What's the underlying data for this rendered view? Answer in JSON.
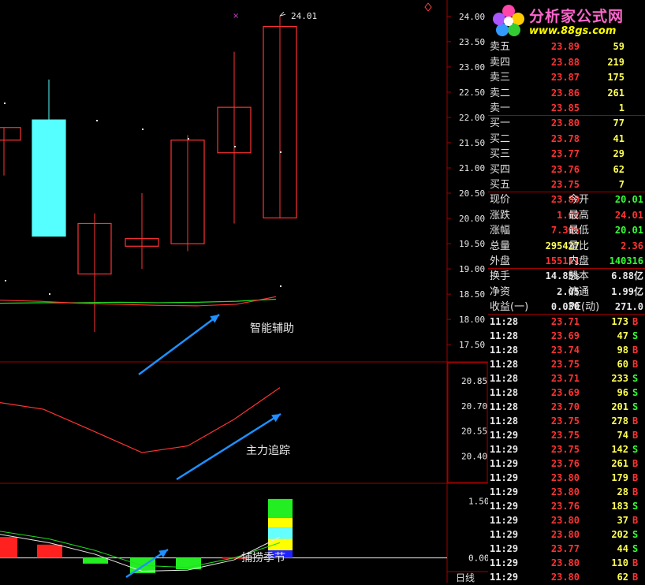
{
  "logo": {
    "brand": "分析家公式网",
    "url": "www.88gs.com"
  },
  "price_axis": [
    "24.00",
    "23.50",
    "23.00",
    "22.50",
    "22.00",
    "21.50",
    "21.00",
    "20.50",
    "20.00",
    "19.50",
    "19.00",
    "18.50",
    "18.00",
    "17.50"
  ],
  "indicator_axis": [
    "20.85",
    "20.70",
    "20.55",
    "20.40"
  ],
  "osc_axis": [
    "1.50",
    "0.00"
  ],
  "high_marker": "24.01",
  "annotations": {
    "ind1": "智能辅助",
    "ind2": "主力追踪",
    "ind3": "捕捞季节"
  },
  "period": "日线",
  "sell_orders": [
    {
      "label": "卖五",
      "price": "23.89",
      "vol": "59"
    },
    {
      "label": "卖四",
      "price": "23.88",
      "vol": "219"
    },
    {
      "label": "卖三",
      "price": "23.87",
      "vol": "175"
    },
    {
      "label": "卖二",
      "price": "23.86",
      "vol": "261"
    },
    {
      "label": "卖一",
      "price": "23.85",
      "vol": "1"
    }
  ],
  "buy_orders": [
    {
      "label": "买一",
      "price": "23.80",
      "vol": "77"
    },
    {
      "label": "买二",
      "price": "23.78",
      "vol": "41"
    },
    {
      "label": "买三",
      "price": "23.77",
      "vol": "29"
    },
    {
      "label": "买四",
      "price": "23.76",
      "vol": "62"
    },
    {
      "label": "买五",
      "price": "23.75",
      "vol": "7"
    }
  ],
  "quote": [
    {
      "l1": "现价",
      "v1": "23.80",
      "c1": "red",
      "l2": "今开",
      "v2": "20.01",
      "c2": "green"
    },
    {
      "l1": "涨跌",
      "v1": "1.62",
      "c1": "red",
      "l2": "最高",
      "v2": "24.01",
      "c2": "red"
    },
    {
      "l1": "涨幅",
      "v1": "7.30%",
      "c1": "red",
      "l2": "最低",
      "v2": "20.01",
      "c2": "green"
    },
    {
      "l1": "总量",
      "v1": "295427",
      "c1": "yellow",
      "l2": "量比",
      "v2": "2.36",
      "c2": "red"
    },
    {
      "l1": "外盘",
      "v1": "155111",
      "c1": "red",
      "l2": "内盘",
      "v2": "140316",
      "c2": "green"
    }
  ],
  "fund": [
    {
      "l1": "换手",
      "v1": "14.85%",
      "l2": "股本",
      "v2": "6.88亿"
    },
    {
      "l1": "净资",
      "v1": "2.05",
      "l2": "流通",
      "v2": "1.99亿"
    },
    {
      "l1": "收益(一)",
      "v1": "0.030",
      "l2": "PE(动)",
      "v2": "271.0"
    }
  ],
  "ticks": [
    {
      "time": "11:28",
      "price": "23.71",
      "pc": "red",
      "vol": "173",
      "side": "B"
    },
    {
      "time": "11:28",
      "price": "23.69",
      "pc": "red",
      "vol": "47",
      "side": "S"
    },
    {
      "time": "11:28",
      "price": "23.74",
      "pc": "red",
      "vol": "98",
      "side": "B"
    },
    {
      "time": "11:28",
      "price": "23.75",
      "pc": "red",
      "vol": "60",
      "side": "B"
    },
    {
      "time": "11:28",
      "price": "23.71",
      "pc": "red",
      "vol": "233",
      "side": "S"
    },
    {
      "time": "11:28",
      "price": "23.69",
      "pc": "red",
      "vol": "96",
      "side": "S"
    },
    {
      "time": "11:28",
      "price": "23.70",
      "pc": "red",
      "vol": "201",
      "side": "S"
    },
    {
      "time": "11:28",
      "price": "23.75",
      "pc": "red",
      "vol": "278",
      "side": "B"
    },
    {
      "time": "11:29",
      "price": "23.75",
      "pc": "red",
      "vol": "74",
      "side": "B"
    },
    {
      "time": "11:29",
      "price": "23.75",
      "pc": "red",
      "vol": "142",
      "side": "S"
    },
    {
      "time": "11:29",
      "price": "23.76",
      "pc": "red",
      "vol": "261",
      "side": "B"
    },
    {
      "time": "11:29",
      "price": "23.80",
      "pc": "red",
      "vol": "179",
      "side": "B"
    },
    {
      "time": "11:29",
      "price": "23.80",
      "pc": "red",
      "vol": "28",
      "side": "B"
    },
    {
      "time": "11:29",
      "price": "23.76",
      "pc": "red",
      "vol": "183",
      "side": "S"
    },
    {
      "time": "11:29",
      "price": "23.80",
      "pc": "red",
      "vol": "37",
      "side": "B"
    },
    {
      "time": "11:29",
      "price": "23.80",
      "pc": "red",
      "vol": "202",
      "side": "S"
    },
    {
      "time": "11:29",
      "price": "23.77",
      "pc": "red",
      "vol": "44",
      "side": "S"
    },
    {
      "time": "11:29",
      "price": "23.80",
      "pc": "red",
      "vol": "110",
      "side": "B"
    },
    {
      "time": "11:29",
      "price": "23.80",
      "pc": "red",
      "vol": "62",
      "side": "B"
    }
  ],
  "colors": {
    "up": "#ff3333",
    "down": "#55ffff",
    "grid": "#a00000",
    "arrow": "#1e90ff",
    "buy_side": "#ff3333",
    "sell_side": "#33ff33"
  },
  "chart_data": {
    "type": "candlestick",
    "candles": [
      {
        "open": 21.55,
        "close": 21.8,
        "high": 21.8,
        "low": 20.85,
        "dir": "up"
      },
      {
        "open": 21.95,
        "close": 19.65,
        "high": 22.75,
        "low": 19.65,
        "dir": "down"
      },
      {
        "open": 18.9,
        "close": 19.9,
        "high": 20.1,
        "low": 17.75,
        "dir": "up"
      },
      {
        "open": 19.45,
        "close": 19.6,
        "high": 20.5,
        "low": 19.0,
        "dir": "up"
      },
      {
        "open": 19.5,
        "close": 21.55,
        "high": 21.65,
        "low": 19.35,
        "dir": "up"
      },
      {
        "open": 21.3,
        "close": 22.2,
        "high": 23.3,
        "low": 19.9,
        "dir": "up"
      },
      {
        "open": 20.01,
        "close": 23.8,
        "high": 24.01,
        "low": 20.01,
        "dir": "up"
      }
    ],
    "price_range": [
      17.3,
      24.2
    ],
    "ma_green": [
      18.32,
      18.33,
      18.33,
      18.34,
      18.33,
      18.34,
      18.36,
      18.4
    ],
    "ma_red": [
      18.38,
      18.36,
      18.32,
      18.3,
      18.28,
      18.27,
      18.3,
      18.45
    ],
    "ind2_line": [
      20.72,
      20.68,
      20.55,
      20.42,
      20.46,
      20.62,
      20.81
    ],
    "ind2_range": [
      20.25,
      20.95
    ],
    "osc_bars": [
      {
        "value": 0.55,
        "color": "#ff2020"
      },
      {
        "value": 0.35,
        "color": "#ff2020"
      },
      {
        "value": -0.15,
        "color": "#22ee22"
      },
      {
        "value": -0.4,
        "color": "#22ee22"
      },
      {
        "value": -0.3,
        "color": "#22ee22"
      },
      {
        "value": 0.02,
        "color": "#ff2020"
      }
    ],
    "osc_stack": [
      {
        "from": 1.05,
        "to": 1.55,
        "color": "#22ee22"
      },
      {
        "from": 0.8,
        "to": 1.05,
        "color": "#ffff00"
      },
      {
        "from": 0.5,
        "to": 0.8,
        "color": "#66ffff"
      },
      {
        "from": 0.2,
        "to": 0.5,
        "color": "#ffff00"
      },
      {
        "from": 0.0,
        "to": 0.2,
        "color": "#2222ff"
      }
    ],
    "osc_line_white": [
      0.62,
      0.4,
      0.1,
      -0.35,
      -0.32,
      -0.05,
      0.55
    ],
    "osc_line_green": [
      0.7,
      0.5,
      0.2,
      -0.2,
      -0.25,
      0.0,
      0.4
    ],
    "osc_range": [
      -0.65,
      1.9
    ]
  }
}
